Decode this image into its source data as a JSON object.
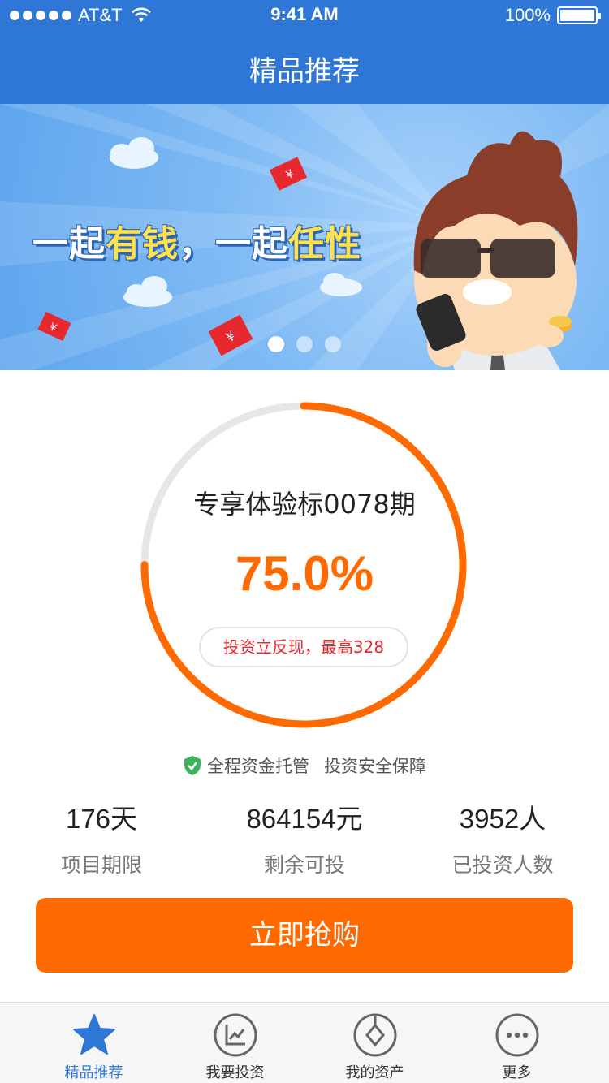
{
  "status_bar": {
    "carrier": "AT&T",
    "time": "9:41 AM",
    "battery": "100%"
  },
  "nav": {
    "title": "精品推荐"
  },
  "banner": {
    "slogan_parts": [
      "一起",
      "有钱",
      "，一起",
      "任性"
    ],
    "active_slide": 1,
    "slide_count": 3
  },
  "product": {
    "name": "专享体验标0078期",
    "progress": 0.75,
    "progress_text": "75.0%",
    "cashback": "投资立反现，最高328"
  },
  "guarantee": {
    "item1": "全程资金托管",
    "item2": "投资安全保障"
  },
  "stats": [
    {
      "value": "176天",
      "label": "项目期限"
    },
    {
      "value": "864154元",
      "label": "剩余可投"
    },
    {
      "value": "3952人",
      "label": "已投资人数"
    }
  ],
  "buy_button": "立即抢购",
  "tabs": [
    {
      "label": "精品推荐",
      "icon": "star-icon",
      "active": true
    },
    {
      "label": "我要投资",
      "icon": "chart-icon",
      "active": false
    },
    {
      "label": "我的资产",
      "icon": "asset-icon",
      "active": false
    },
    {
      "label": "更多",
      "icon": "more-icon",
      "active": false
    }
  ],
  "colors": {
    "primary": "#2f77d6",
    "accent": "#ff6a00",
    "ring_track": "#e6e6e6",
    "cashback_text": "#e8282f",
    "shield": "#3cb35e"
  }
}
